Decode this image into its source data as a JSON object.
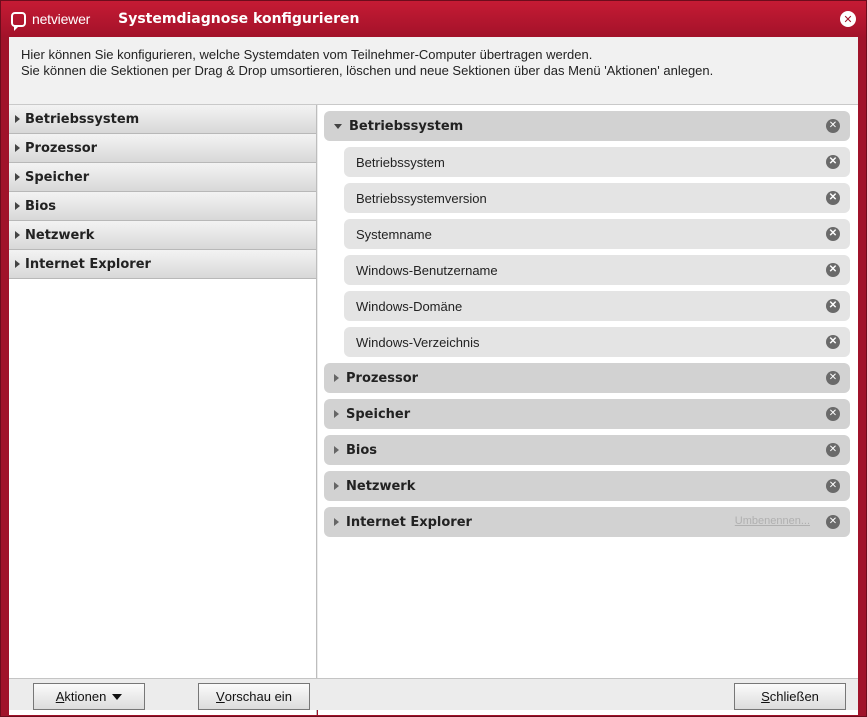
{
  "titlebar": {
    "logo_text": "netviewer",
    "title": "Systemdiagnose konfigurieren",
    "close_icon": "close-icon"
  },
  "info": {
    "line1": "Hier können Sie konfigurieren, welche Systemdaten vom Teilnehmer-Computer übertragen werden.",
    "line2": "Sie können die Sektionen per Drag & Drop umsortieren, löschen und neue Sektionen über das Menü 'Aktionen' anlegen."
  },
  "left_items": [
    {
      "label": "Betriebssystem"
    },
    {
      "label": "Prozessor"
    },
    {
      "label": "Speicher"
    },
    {
      "label": "Bios"
    },
    {
      "label": "Netzwerk"
    },
    {
      "label": "Internet Explorer"
    }
  ],
  "right": {
    "expanded_section": {
      "label": "Betriebssystem",
      "items": [
        {
          "label": "Betriebssystem"
        },
        {
          "label": "Betriebssystemversion"
        },
        {
          "label": "Systemname"
        },
        {
          "label": "Windows-Benutzername"
        },
        {
          "label": "Windows-Domäne"
        },
        {
          "label": "Windows-Verzeichnis"
        }
      ]
    },
    "collapsed_sections": [
      {
        "label": "Prozessor"
      },
      {
        "label": "Speicher"
      },
      {
        "label": "Bios"
      },
      {
        "label": "Netzwerk"
      },
      {
        "label": "Internet Explorer",
        "rename_link": "Umbenennen..."
      }
    ]
  },
  "buttons": {
    "aktionen_mnemonic": "A",
    "aktionen_rest": "ktionen",
    "vorschau_mnemonic": "V",
    "vorschau_rest": "orschau ein",
    "schliessen_mnemonic": "S",
    "schliessen_rest": "chließen"
  },
  "colors": {
    "window_frame": "#a0132a",
    "section_header": "#d2d2d2",
    "sub_item": "#e4e4e4"
  }
}
